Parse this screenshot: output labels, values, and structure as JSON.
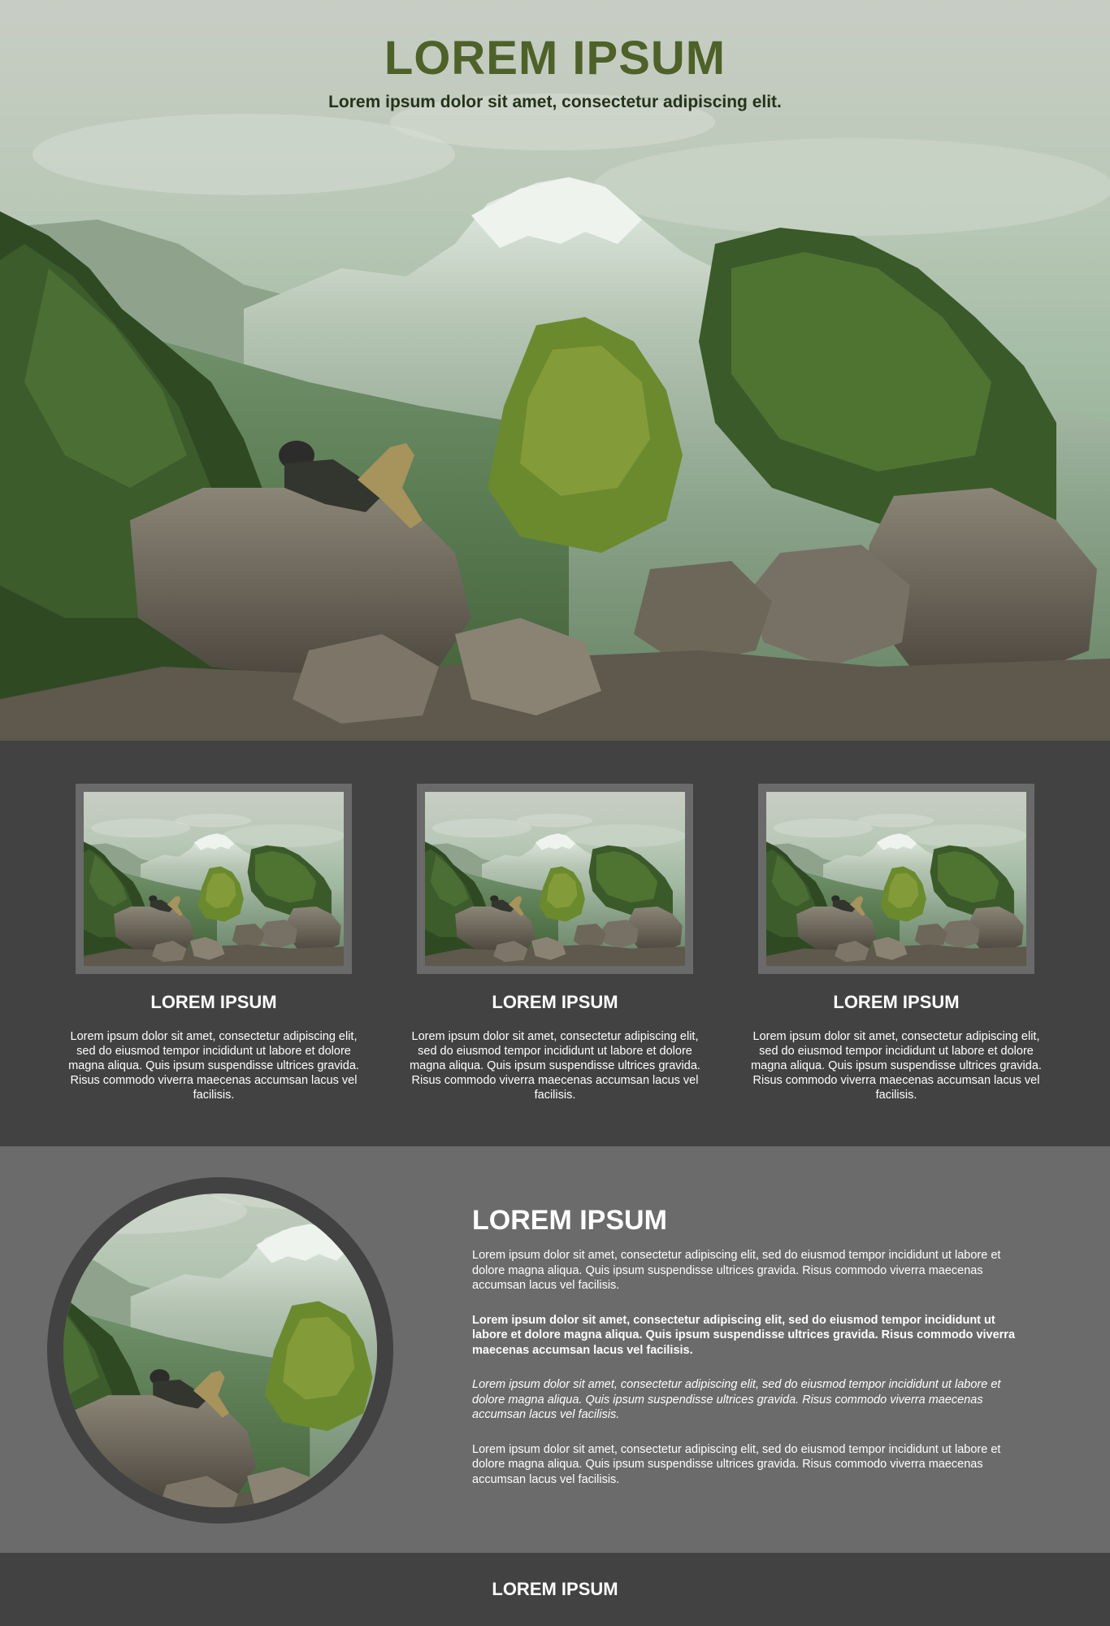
{
  "hero": {
    "title": "LOREM IPSUM",
    "subtitle": "Lorem ipsum dolor sit amet, consectetur adipiscing elit.",
    "image": "mountain-landscape-hiker-on-rocks"
  },
  "features": {
    "cards": [
      {
        "title": "LOREM IPSUM",
        "text": "Lorem ipsum dolor sit amet, consectetur adipiscing elit, sed do eiusmod tempor incididunt ut labore et dolore magna aliqua. Quis ipsum suspendisse ultrices gravida. Risus commodo viverra maecenas accumsan lacus vel facilisis."
      },
      {
        "title": "LOREM IPSUM",
        "text": "Lorem ipsum dolor sit amet, consectetur adipiscing elit, sed do eiusmod tempor incididunt ut labore et dolore magna aliqua. Quis ipsum suspendisse ultrices gravida. Risus commodo viverra maecenas accumsan lacus vel facilisis."
      },
      {
        "title": "LOREM IPSUM",
        "text": "Lorem ipsum dolor sit amet, consectetur adipiscing elit, sed do eiusmod tempor incididunt ut labore et dolore magna aliqua. Quis ipsum suspendisse ultrices gravida. Risus commodo viverra maecenas accumsan lacus vel facilisis."
      }
    ]
  },
  "about": {
    "title": "LOREM IPSUM",
    "paragraphs": [
      "Lorem ipsum dolor sit amet, consectetur adipiscing elit, sed do eiusmod tempor incididunt ut labore et dolore magna aliqua. Quis ipsum suspendisse ultrices gravida. Risus commodo viverra maecenas accumsan lacus vel facilisis.",
      "Lorem ipsum dolor sit amet, consectetur adipiscing elit, sed do eiusmod tempor incididunt ut labore et dolore magna aliqua. Quis ipsum suspendisse ultrices gravida. Risus commodo viverra maecenas accumsan lacus vel facilisis.",
      "Lorem ipsum dolor sit amet, consectetur adipiscing elit, sed do eiusmod tempor incididunt ut labore et dolore magna aliqua. Quis ipsum suspendisse ultrices gravida. Risus commodo viverra maecenas accumsan lacus vel facilisis.",
      "Lorem ipsum dolor sit amet, consectetur adipiscing elit, sed do eiusmod tempor incididunt ut labore et dolore magna aliqua. Quis ipsum suspendisse ultrices gravida. Risus commodo viverra maecenas accumsan lacus vel facilisis."
    ]
  },
  "footer": {
    "title": "LOREM IPSUM"
  },
  "colors": {
    "hero_title": "#4e6129",
    "hero_subtitle": "#24331a",
    "dark_band": "#424242",
    "mid_band": "#6b6b6b",
    "frame": "#6a6a6a"
  }
}
